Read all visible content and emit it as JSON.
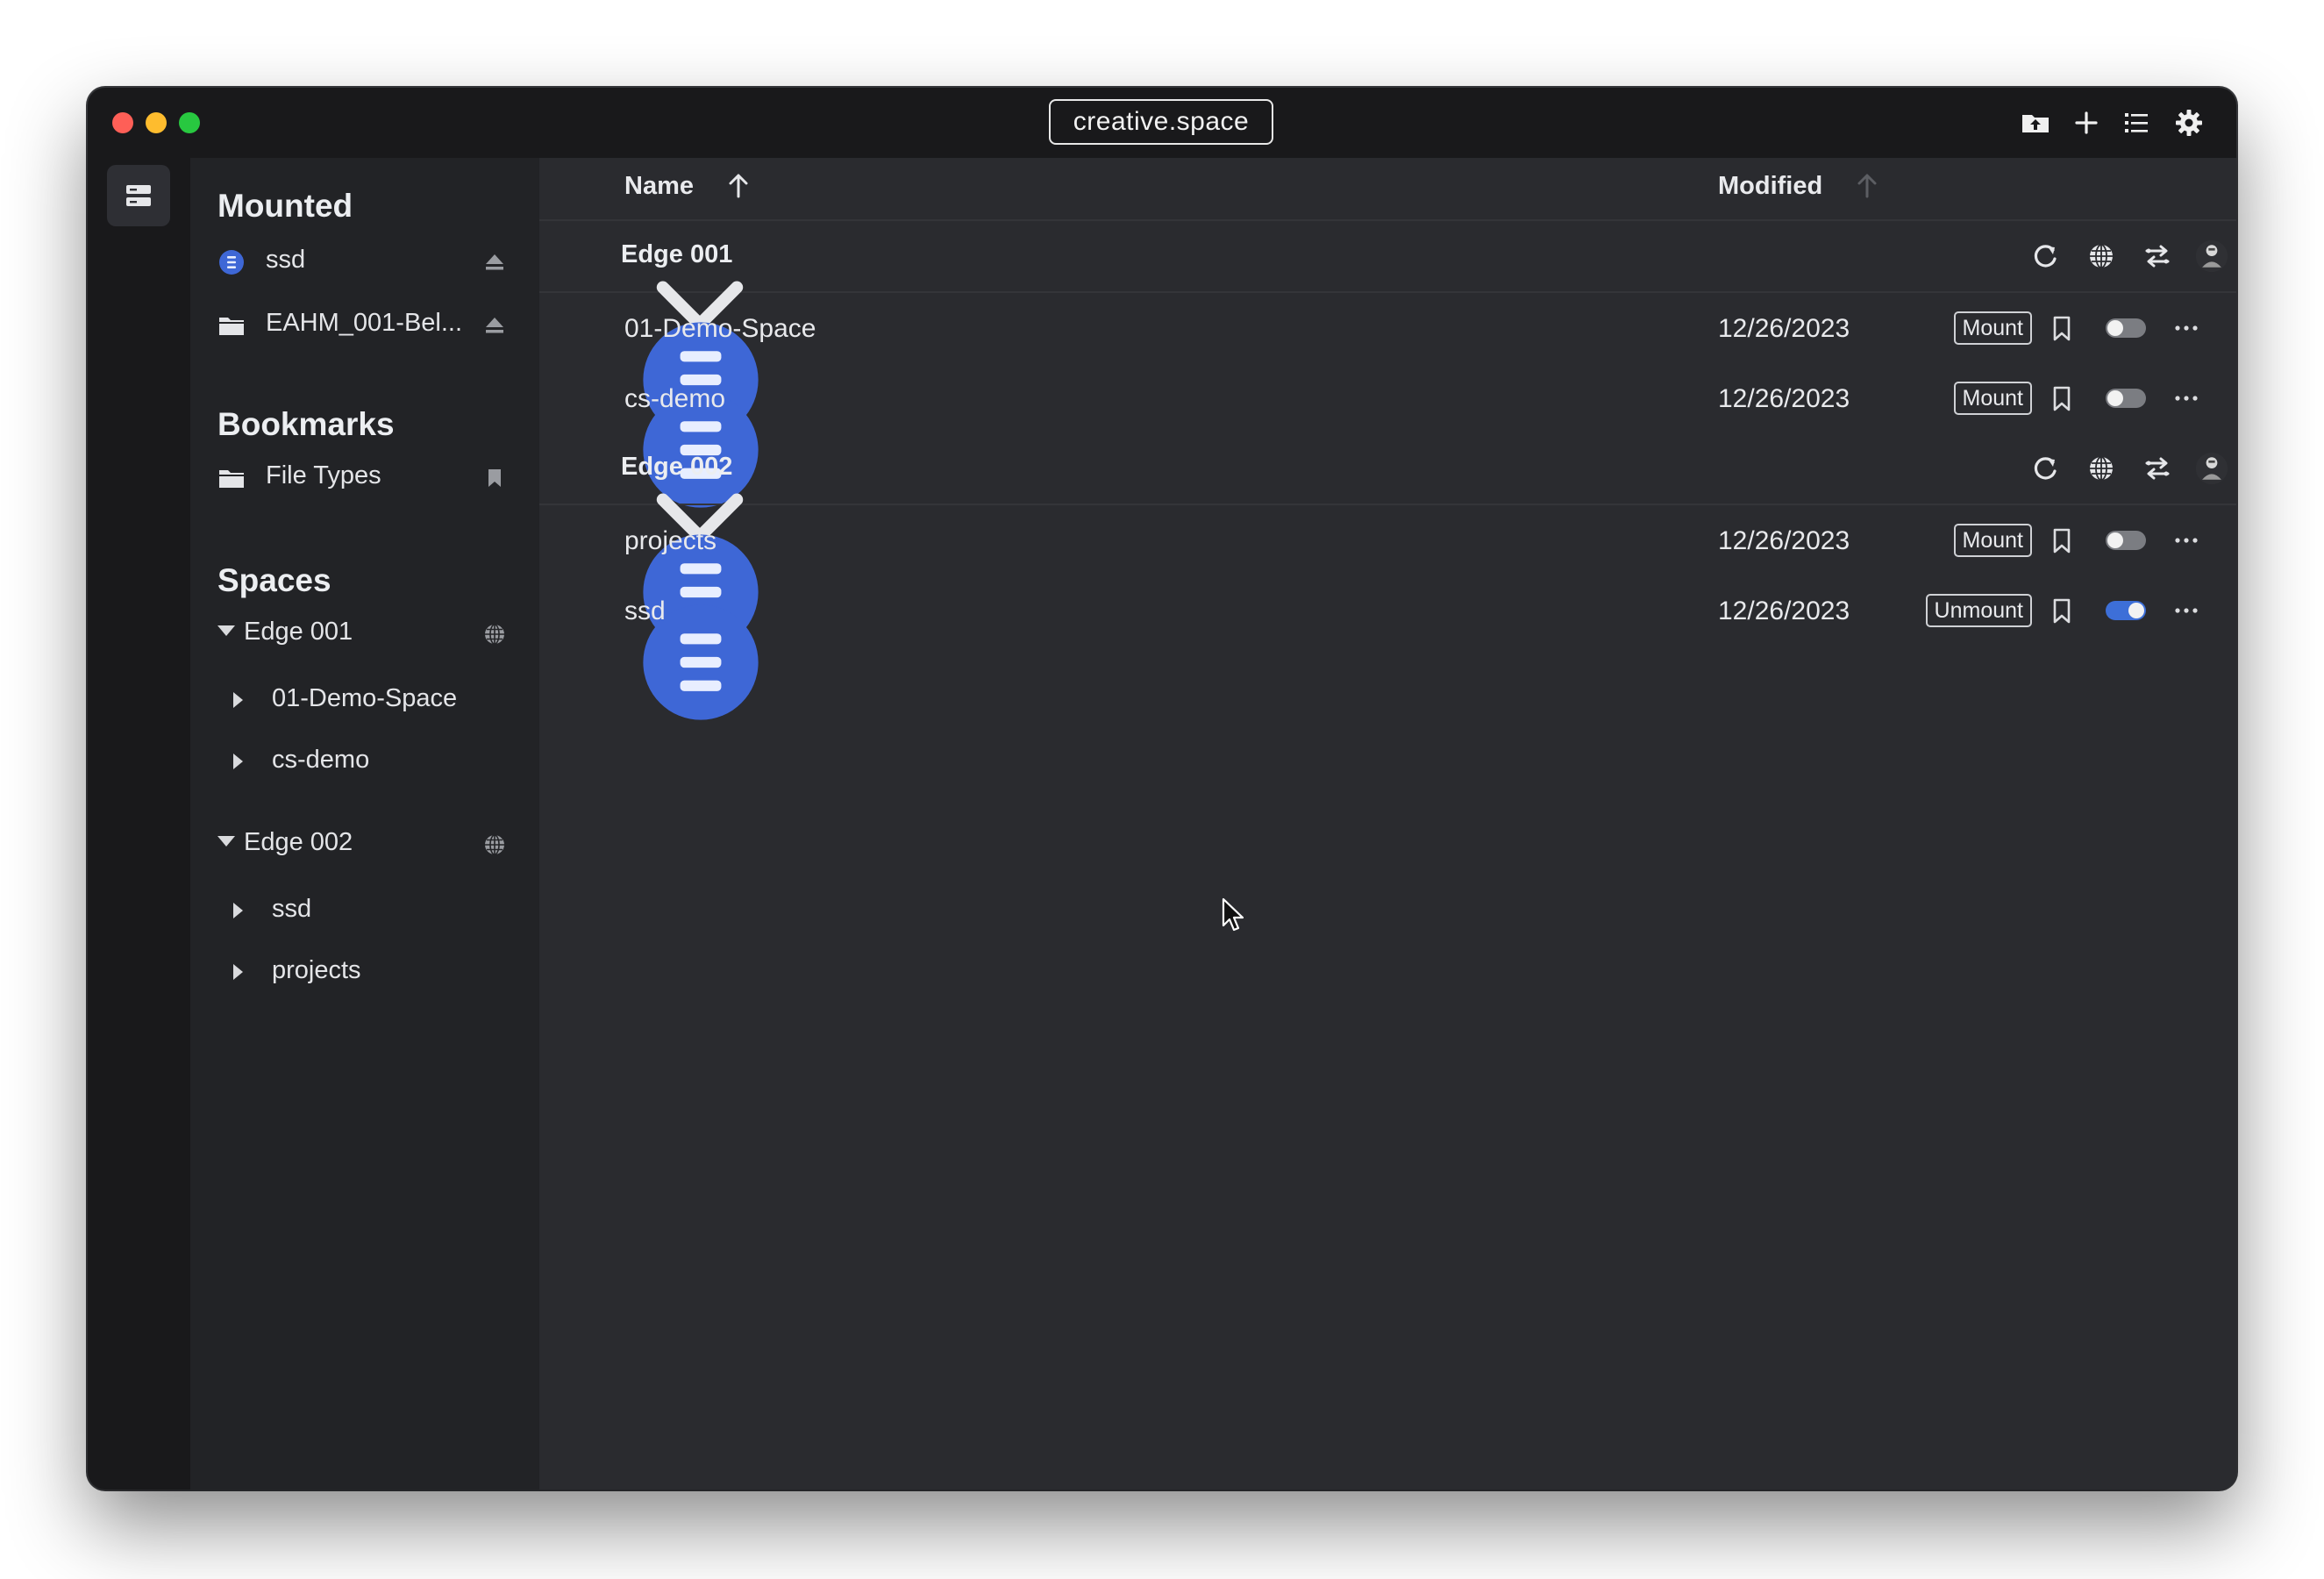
{
  "window": {
    "title": "creative.space"
  },
  "toolbar": {
    "icons": [
      "folder-upload-icon",
      "plus-icon",
      "list-icon",
      "settings-gear-icon"
    ]
  },
  "rail": {
    "icons": [
      "storage-icon"
    ]
  },
  "sidebar": {
    "mounted": {
      "heading": "Mounted",
      "items": [
        {
          "label": "ssd",
          "icon": "drive-icon",
          "action": "eject-icon"
        },
        {
          "label": "EAHM_001-Bel...",
          "icon": "folder-icon",
          "action": "eject-icon"
        }
      ]
    },
    "bookmarks": {
      "heading": "Bookmarks",
      "items": [
        {
          "label": "File Types",
          "icon": "folder-icon",
          "action": "bookmark-icon"
        }
      ]
    },
    "spaces": {
      "heading": "Spaces",
      "groups": [
        {
          "label": "Edge 001",
          "action": "globe-icon",
          "children": [
            "01-Demo-Space",
            "cs-demo"
          ]
        },
        {
          "label": "Edge 002",
          "action": "globe-icon",
          "children": [
            "ssd",
            "projects"
          ]
        }
      ]
    }
  },
  "table": {
    "columns": {
      "name": "Name",
      "modified": "Modified"
    },
    "group_icons": [
      "refresh-icon",
      "globe-icon",
      "sync-icon",
      "user-avatar-icon"
    ],
    "groups": [
      {
        "name": "Edge 001",
        "rows": [
          {
            "name": "01-Demo-Space",
            "modified": "12/26/2023",
            "action": "Mount",
            "toggle_on": false
          },
          {
            "name": "cs-demo",
            "modified": "12/26/2023",
            "action": "Mount",
            "toggle_on": false
          }
        ]
      },
      {
        "name": "Edge 002",
        "rows": [
          {
            "name": "projects",
            "modified": "12/26/2023",
            "action": "Mount",
            "toggle_on": false
          },
          {
            "name": "ssd",
            "modified": "12/26/2023",
            "action": "Unmount",
            "toggle_on": true
          }
        ]
      }
    ]
  },
  "colors": {
    "accent": "#3d6fd8",
    "background": "#2a2b2f",
    "sidebar": "#222326",
    "titlebar": "#19191b"
  }
}
